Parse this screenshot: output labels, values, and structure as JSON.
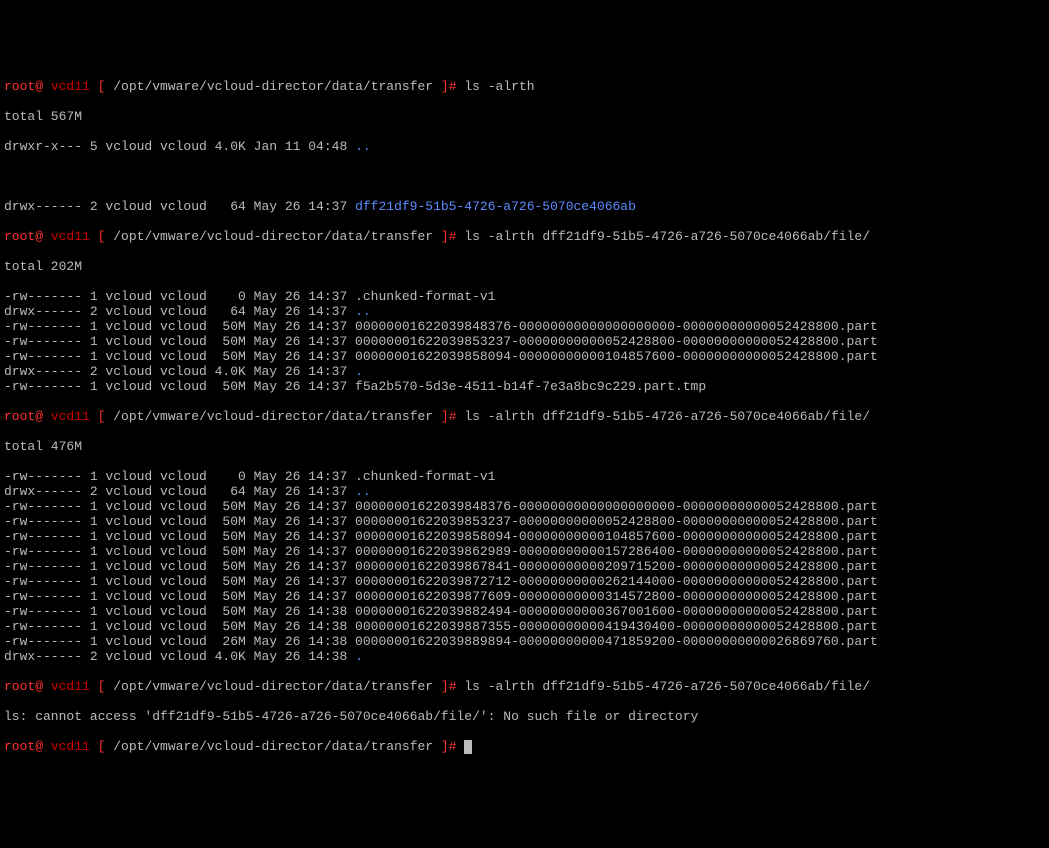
{
  "prompt": {
    "user_at": "root@",
    "host": "vcd11",
    "open": " [ ",
    "path": "/opt/vmware/vcloud-director/data/transfer",
    "close": " ]# "
  },
  "cmds": {
    "ls1": "ls -alrth",
    "ls2": "ls -alrth dff21df9-51b5-4726-a726-5070ce4066ab/file/",
    "ls3": "ls -alrth dff21df9-51b5-4726-a726-5070ce4066ab/file/",
    "ls4": "ls -alrth dff21df9-51b5-4726-a726-5070ce4066ab/file/"
  },
  "totals": {
    "t1": "total 567M",
    "t2": "total 202M",
    "t3": "total 476M"
  },
  "listing1": {
    "parent": "drwxr-x--- 5 vcloud vcloud 4.0K Jan 11 04:48 ",
    "blank": " ",
    "row1a": "drwx------ 2 vcloud vcloud   64 May 26 14:37 ",
    "row1a_name": "dff21df9-51b5-4726-a726-5070ce4066ab",
    "dotdot": ".."
  },
  "listing2": [
    "-rw------- 1 vcloud vcloud    0 May 26 14:37 .chunked-format-v1",
    "drwx------ 2 vcloud vcloud   64 May 26 14:37 ",
    "-rw------- 1 vcloud vcloud  50M May 26 14:37 00000001622039848376-00000000000000000000-00000000000052428800.part",
    "-rw------- 1 vcloud vcloud  50M May 26 14:37 00000001622039853237-00000000000052428800-00000000000052428800.part",
    "-rw------- 1 vcloud vcloud  50M May 26 14:37 00000001622039858094-00000000000104857600-00000000000052428800.part",
    "drwx------ 2 vcloud vcloud 4.0K May 26 14:37 ",
    "-rw------- 1 vcloud vcloud  50M May 26 14:37 f5a2b570-5d3e-4511-b14f-7e3a8bc9c229.part.tmp"
  ],
  "listing2_dotdot_idx": 1,
  "listing2_dot_idx": 5,
  "listing3": [
    "-rw------- 1 vcloud vcloud    0 May 26 14:37 .chunked-format-v1",
    "drwx------ 2 vcloud vcloud   64 May 26 14:37 ",
    "-rw------- 1 vcloud vcloud  50M May 26 14:37 00000001622039848376-00000000000000000000-00000000000052428800.part",
    "-rw------- 1 vcloud vcloud  50M May 26 14:37 00000001622039853237-00000000000052428800-00000000000052428800.part",
    "-rw------- 1 vcloud vcloud  50M May 26 14:37 00000001622039858094-00000000000104857600-00000000000052428800.part",
    "-rw------- 1 vcloud vcloud  50M May 26 14:37 00000001622039862989-00000000000157286400-00000000000052428800.part",
    "-rw------- 1 vcloud vcloud  50M May 26 14:37 00000001622039867841-00000000000209715200-00000000000052428800.part",
    "-rw------- 1 vcloud vcloud  50M May 26 14:37 00000001622039872712-00000000000262144000-00000000000052428800.part",
    "-rw------- 1 vcloud vcloud  50M May 26 14:37 00000001622039877609-00000000000314572800-00000000000052428800.part",
    "-rw------- 1 vcloud vcloud  50M May 26 14:38 00000001622039882494-00000000000367001600-00000000000052428800.part",
    "-rw------- 1 vcloud vcloud  50M May 26 14:38 00000001622039887355-00000000000419430400-00000000000052428800.part",
    "-rw------- 1 vcloud vcloud  26M May 26 14:38 00000001622039889894-00000000000471859200-00000000000026869760.part",
    "drwx------ 2 vcloud vcloud 4.0K May 26 14:38 "
  ],
  "listing3_dotdot_idx": 1,
  "listing3_dot_idx": 12,
  "err": "ls: cannot access 'dff21df9-51b5-4726-a726-5070ce4066ab/file/': No such file or directory",
  "dot": ".",
  "dotdot": ".."
}
